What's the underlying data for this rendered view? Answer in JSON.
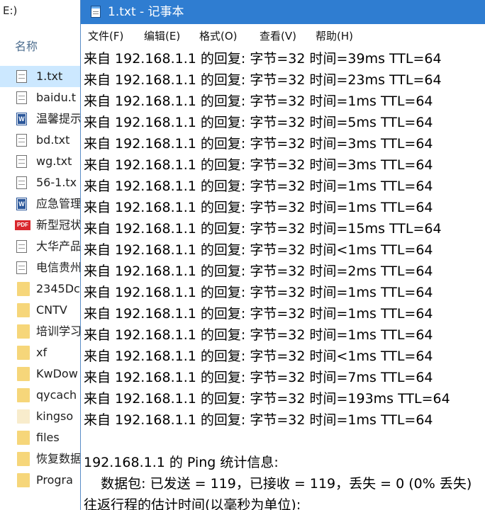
{
  "explorer": {
    "path_fragment": "E:)",
    "column_header": "名称",
    "files": [
      {
        "name": "1.txt",
        "icon": "txt",
        "selected": true
      },
      {
        "name": "baidu.t",
        "icon": "txt"
      },
      {
        "name": "温馨提示",
        "icon": "doc"
      },
      {
        "name": "bd.txt",
        "icon": "txt"
      },
      {
        "name": "wg.txt",
        "icon": "txt"
      },
      {
        "name": "56-1.tx",
        "icon": "txt"
      },
      {
        "name": "应急管理",
        "icon": "doc"
      },
      {
        "name": "新型冠状",
        "icon": "pdf"
      },
      {
        "name": "大华产品",
        "icon": "txt"
      },
      {
        "name": "电信贵州",
        "icon": "txt"
      },
      {
        "name": "2345Dc",
        "icon": "folder"
      },
      {
        "name": "CNTV",
        "icon": "folder"
      },
      {
        "name": "培训学习",
        "icon": "folder"
      },
      {
        "name": "xf",
        "icon": "folder"
      },
      {
        "name": "KwDow",
        "icon": "folder"
      },
      {
        "name": "qycach",
        "icon": "folder"
      },
      {
        "name": "kingso",
        "icon": "folder-pale"
      },
      {
        "name": "files",
        "icon": "folder"
      },
      {
        "name": "恢复数据",
        "icon": "folder"
      },
      {
        "name": "Progra",
        "icon": "folder"
      }
    ]
  },
  "notepad": {
    "title": "1.txt - 记事本",
    "menu": [
      "文件(F)",
      "编辑(E)",
      "格式(O)",
      "查看(V)",
      "帮助(H)"
    ],
    "lines": [
      "来自 192.168.1.1 的回复: 字节=32 时间=39ms TTL=64",
      "来自 192.168.1.1 的回复: 字节=32 时间=23ms TTL=64",
      "来自 192.168.1.1 的回复: 字节=32 时间=1ms TTL=64",
      "来自 192.168.1.1 的回复: 字节=32 时间=5ms TTL=64",
      "来自 192.168.1.1 的回复: 字节=32 时间=3ms TTL=64",
      "来自 192.168.1.1 的回复: 字节=32 时间=3ms TTL=64",
      "来自 192.168.1.1 的回复: 字节=32 时间=1ms TTL=64",
      "来自 192.168.1.1 的回复: 字节=32 时间=1ms TTL=64",
      "来自 192.168.1.1 的回复: 字节=32 时间=15ms TTL=64",
      "来自 192.168.1.1 的回复: 字节=32 时间<1ms TTL=64",
      "来自 192.168.1.1 的回复: 字节=32 时间=2ms TTL=64",
      "来自 192.168.1.1 的回复: 字节=32 时间=1ms TTL=64",
      "来自 192.168.1.1 的回复: 字节=32 时间=1ms TTL=64",
      "来自 192.168.1.1 的回复: 字节=32 时间=1ms TTL=64",
      "来自 192.168.1.1 的回复: 字节=32 时间<1ms TTL=64",
      "来自 192.168.1.1 的回复: 字节=32 时间=7ms TTL=64",
      "来自 192.168.1.1 的回复: 字节=32 时间=193ms TTL=64",
      "来自 192.168.1.1 的回复: 字节=32 时间=1ms TTL=64",
      "",
      "192.168.1.1 的 Ping 统计信息:",
      "    数据包: 已发送 = 119，已接收 = 119，丢失 = 0 (0% 丢失)",
      "往返行程的估计时间(以毫秒为单位):"
    ]
  },
  "colors": {
    "titlebar": "#2f7dd1",
    "selection": "#cce8ff",
    "folder": "#f6d67a",
    "pdf": "#d9272d"
  }
}
